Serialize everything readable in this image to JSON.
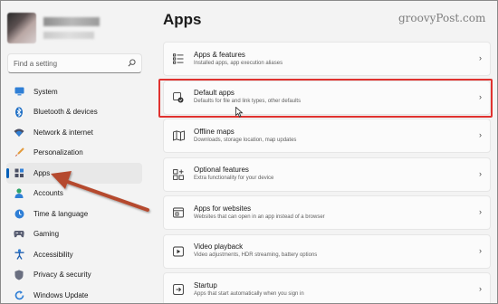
{
  "watermark": "groovyPost.com",
  "sidebar": {
    "search_placeholder": "Find a setting",
    "items": [
      {
        "label": "System",
        "icon": "monitor-icon"
      },
      {
        "label": "Bluetooth & devices",
        "icon": "bluetooth-icon"
      },
      {
        "label": "Network & internet",
        "icon": "wifi-icon"
      },
      {
        "label": "Personalization",
        "icon": "brush-icon"
      },
      {
        "label": "Apps",
        "icon": "apps-icon",
        "selected": true
      },
      {
        "label": "Accounts",
        "icon": "person-icon"
      },
      {
        "label": "Time & language",
        "icon": "globe-clock-icon"
      },
      {
        "label": "Gaming",
        "icon": "gamepad-icon"
      },
      {
        "label": "Accessibility",
        "icon": "accessibility-icon"
      },
      {
        "label": "Privacy & security",
        "icon": "shield-icon"
      },
      {
        "label": "Windows Update",
        "icon": "update-icon"
      }
    ]
  },
  "main": {
    "title": "Apps",
    "cards": [
      {
        "title": "Apps & features",
        "desc": "Installed apps, app execution aliases",
        "icon": "list-icon"
      },
      {
        "title": "Default apps",
        "desc": "Defaults for file and link types, other defaults",
        "icon": "default-apps-icon",
        "highlighted": true
      },
      {
        "title": "Offline maps",
        "desc": "Downloads, storage location, map updates",
        "icon": "map-icon"
      },
      {
        "title": "Optional features",
        "desc": "Extra functionality for your device",
        "icon": "add-square-icon"
      },
      {
        "title": "Apps for websites",
        "desc": "Websites that can open in an app instead of a browser",
        "icon": "web-app-icon"
      },
      {
        "title": "Video playback",
        "desc": "Video adjustments, HDR streaming, battery options",
        "icon": "video-icon"
      },
      {
        "title": "Startup",
        "desc": "Apps that start automatically when you sign in",
        "icon": "startup-icon"
      }
    ]
  },
  "colors": {
    "accent": "#005fb8",
    "highlight": "#e0322f",
    "annotation_arrow": "#b5492d"
  }
}
